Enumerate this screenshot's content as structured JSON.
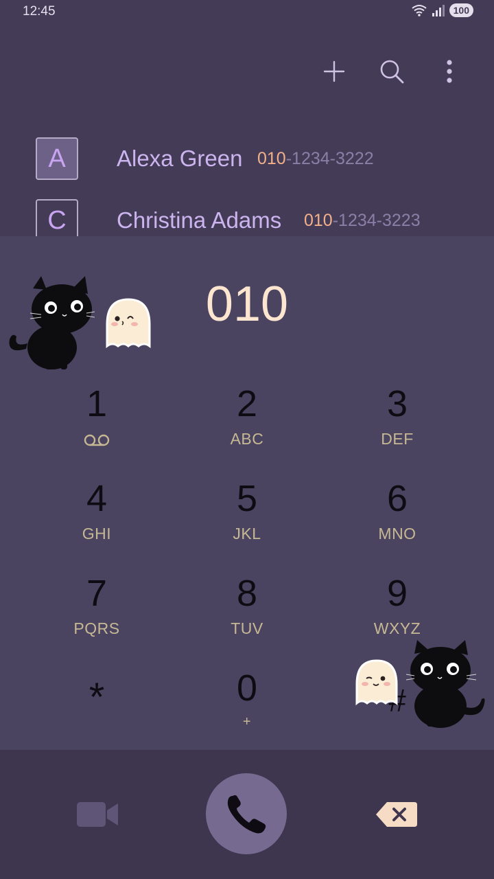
{
  "status_bar": {
    "time": "12:45",
    "battery": "100"
  },
  "top_actions": {
    "add": "add-icon",
    "search": "search-icon",
    "more": "more-vert-icon"
  },
  "results": [
    {
      "initial": "A",
      "name": "Alexa Green",
      "number_match": "010",
      "number_rest": "-1234-3222"
    },
    {
      "initial": "C",
      "name": "Christina Adams",
      "number_match": "010",
      "number_rest": "-1234-3223"
    }
  ],
  "dialed_number": "010",
  "keypad": [
    {
      "digit": "1",
      "letters": ""
    },
    {
      "digit": "2",
      "letters": "ABC"
    },
    {
      "digit": "3",
      "letters": "DEF"
    },
    {
      "digit": "4",
      "letters": "GHI"
    },
    {
      "digit": "5",
      "letters": "JKL"
    },
    {
      "digit": "6",
      "letters": "MNO"
    },
    {
      "digit": "7",
      "letters": "PQRS"
    },
    {
      "digit": "8",
      "letters": "TUV"
    },
    {
      "digit": "9",
      "letters": "WXYZ"
    },
    {
      "digit": "*",
      "letters": ""
    },
    {
      "digit": "0",
      "letters": "+"
    },
    {
      "digit": "#",
      "letters": ""
    }
  ],
  "colors": {
    "background": "#443c57",
    "accent": "#766a90",
    "match_highlight": "#f1b08a",
    "name_text": "#ccb4ef"
  }
}
